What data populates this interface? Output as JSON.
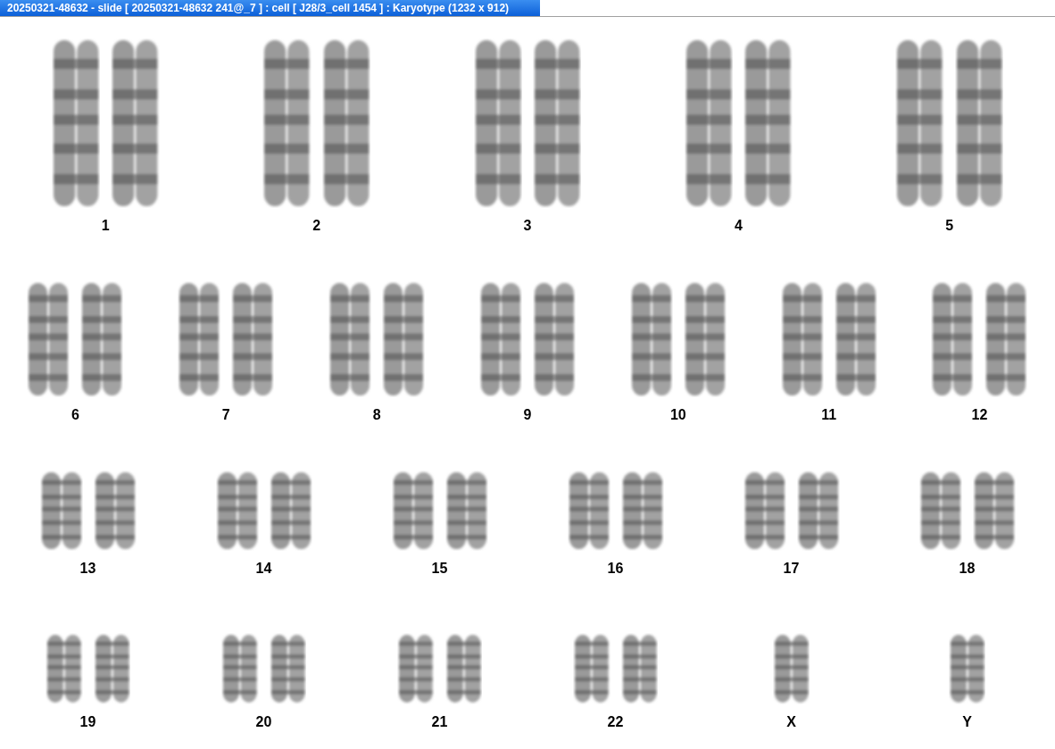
{
  "window": {
    "title": "20250321-48632 - slide [ 20250321-48632 241@_7 ] : cell [ J28/3_cell 1454 ] : Karyotype  (1232 x 912)"
  },
  "karyotype": {
    "rows": [
      [
        {
          "label": "1",
          "kind": "pair"
        },
        {
          "label": "2",
          "kind": "pair"
        },
        {
          "label": "3",
          "kind": "pair"
        },
        {
          "label": "4",
          "kind": "pair"
        },
        {
          "label": "5",
          "kind": "pair"
        }
      ],
      [
        {
          "label": "6",
          "kind": "pair"
        },
        {
          "label": "7",
          "kind": "pair"
        },
        {
          "label": "8",
          "kind": "pair"
        },
        {
          "label": "9",
          "kind": "pair"
        },
        {
          "label": "10",
          "kind": "pair"
        },
        {
          "label": "11",
          "kind": "pair"
        },
        {
          "label": "12",
          "kind": "pair"
        }
      ],
      [
        {
          "label": "13",
          "kind": "pair"
        },
        {
          "label": "14",
          "kind": "pair"
        },
        {
          "label": "15",
          "kind": "pair"
        },
        {
          "label": "16",
          "kind": "pair"
        },
        {
          "label": "17",
          "kind": "pair"
        },
        {
          "label": "18",
          "kind": "pair"
        }
      ],
      [
        {
          "label": "19",
          "kind": "pair"
        },
        {
          "label": "20",
          "kind": "pair"
        },
        {
          "label": "21",
          "kind": "pair"
        },
        {
          "label": "22",
          "kind": "pair"
        },
        {
          "label": "X",
          "kind": "single"
        },
        {
          "label": "Y",
          "kind": "single"
        }
      ]
    ]
  }
}
